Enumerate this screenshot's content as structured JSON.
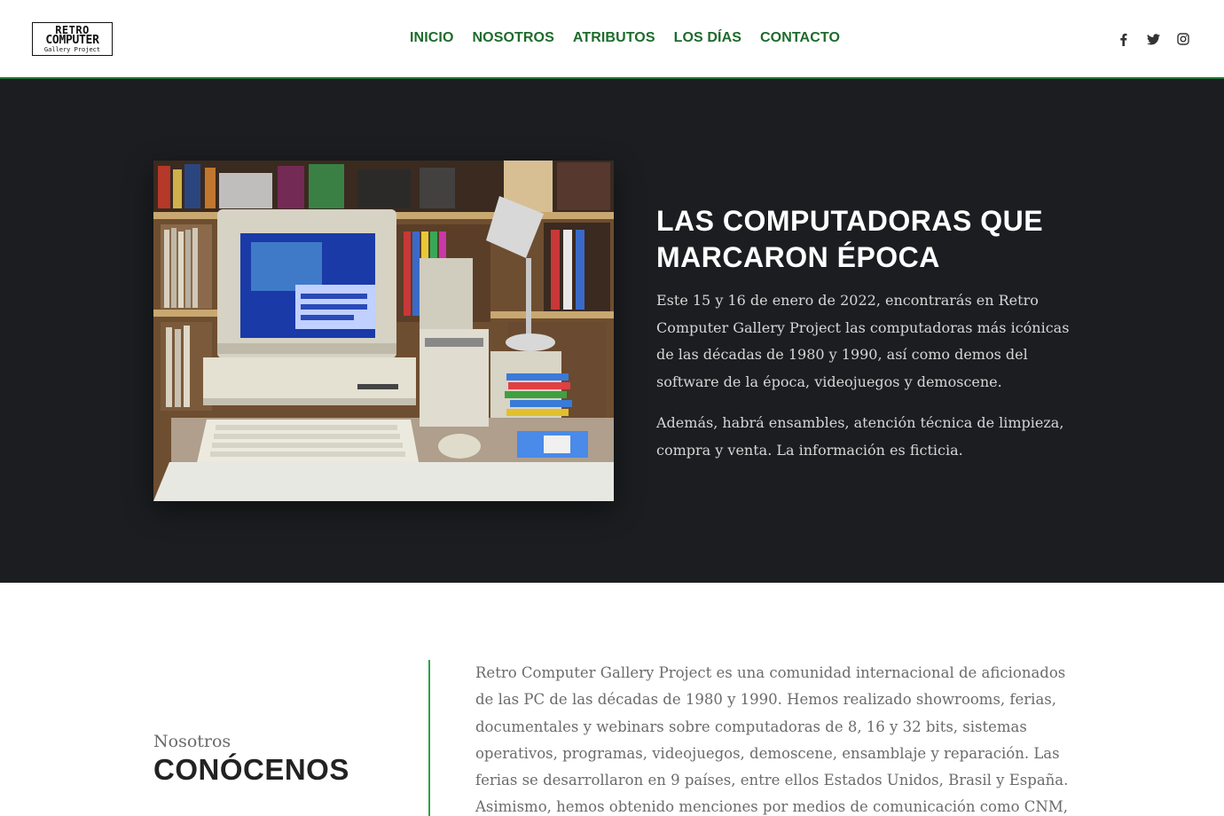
{
  "header": {
    "logo": {
      "line1": "RETRO",
      "line2": "COMPUTER",
      "line3": "Gallery Project"
    },
    "nav": [
      {
        "label": "INICIO"
      },
      {
        "label": "NOSOTROS"
      },
      {
        "label": "ATRIBUTOS"
      },
      {
        "label": "LOS DÍAS"
      },
      {
        "label": "CONTACTO"
      }
    ],
    "social": [
      {
        "icon": "facebook-icon"
      },
      {
        "icon": "twitter-icon"
      },
      {
        "icon": "instagram-icon"
      }
    ]
  },
  "hero": {
    "image_alt": "retro computer setup photo",
    "title": "LAS COMPUTADORAS QUE MARCARON ÉPOCA",
    "paragraph1": "Este 15 y 16 de enero de 2022, encontrarás en Retro Computer Gallery Project las computadoras más icónicas de las décadas de 1980 y 1990, así como demos del software de la época, videojuegos y demoscene.",
    "paragraph2": "Además, habrá ensambles, atención técnica de limpieza, compra y venta. La información es ficticia."
  },
  "about": {
    "kicker": "Nosotros",
    "title": "CONÓCENOS",
    "text": "Retro Computer Gallery Project es una comunidad internacional de aficionados de las PC de las décadas de 1980 y 1990. Hemos realizado showrooms, ferias, documentales y webinars sobre computadoras de 8, 16 y 32 bits, sistemas operativos, programas, videojuegos, demoscene, ensamblaje y reparación. Las ferias se desarrollaron en 9 países, entre ellos Estados Unidos, Brasil y España. Asimismo, hemos obtenido menciones por medios de comunicación como CNM, Xataka y Mashable, y de Youtubers"
  },
  "colors": {
    "nav": "#1e6b2c",
    "hero_bg": "#1b1d20",
    "accent_rule": "#2fa14a"
  }
}
